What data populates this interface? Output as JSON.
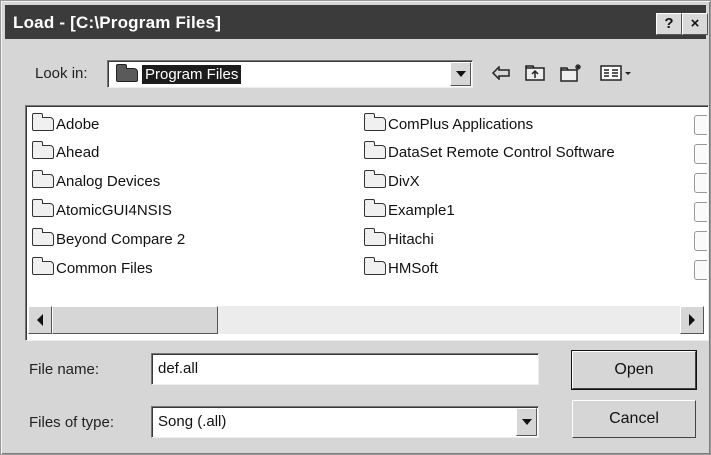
{
  "window": {
    "title": "Load - [C:\\Program Files]",
    "help_label": "?",
    "close_label": "×"
  },
  "look_in": {
    "label": "Look in:",
    "value": "Program Files"
  },
  "toolbar": {
    "icons": [
      "back-icon",
      "up-folder-icon",
      "new-folder-icon",
      "view-menu-icon"
    ]
  },
  "folders": {
    "column1": [
      "Adobe",
      "Ahead",
      "Analog Devices",
      "AtomicGUI4NSIS",
      "Beyond Compare 2",
      "Common Files"
    ],
    "column2": [
      "ComPlus Applications",
      "DataSet Remote Control Software",
      "DivX",
      "Example1",
      "Hitachi",
      "HMSoft"
    ]
  },
  "file_name": {
    "label": "File name:",
    "value": "def.all"
  },
  "file_type": {
    "label": "Files of type:",
    "value": "Song (.all)"
  },
  "buttons": {
    "open": "Open",
    "cancel": "Cancel"
  }
}
